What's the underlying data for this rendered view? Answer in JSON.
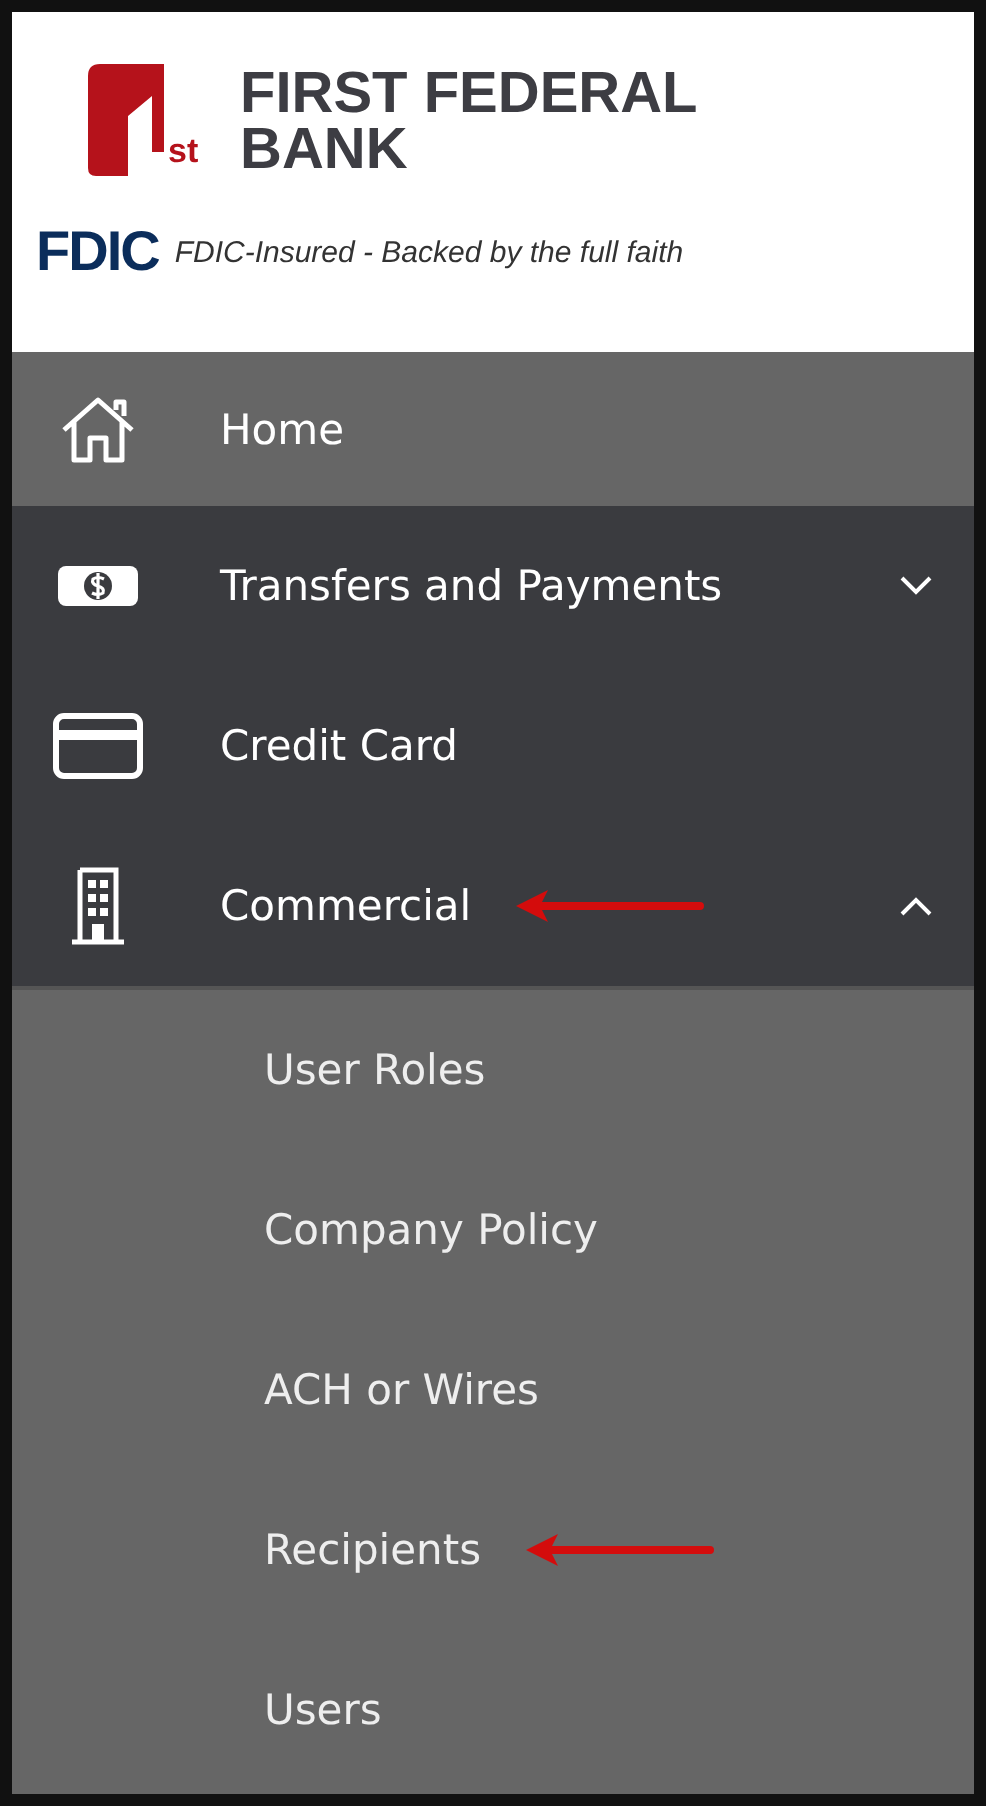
{
  "header": {
    "logo_mark": "st",
    "bank_name": [
      "FIRST FEDERAL",
      "BANK"
    ],
    "fdic_logo": "FDIC",
    "fdic_tagline": "FDIC-Insured - Backed by the full faith"
  },
  "nav": [
    {
      "label": "Home",
      "kind": "home",
      "selected": true
    },
    {
      "label": "Transfers and Payments",
      "kind": "money",
      "selected": false,
      "expanded": false
    },
    {
      "label": "Credit Card",
      "kind": "card",
      "selected": false
    },
    {
      "label": "Commercial",
      "kind": "building",
      "selected": false,
      "expanded": true,
      "pointed": true,
      "children": [
        {
          "label": "User Roles",
          "pointed": false
        },
        {
          "label": "Company Policy",
          "pointed": false
        },
        {
          "label": "ACH or Wires",
          "pointed": false
        },
        {
          "label": "Recipients",
          "pointed": true
        },
        {
          "label": "Users",
          "pointed": false
        }
      ]
    }
  ]
}
